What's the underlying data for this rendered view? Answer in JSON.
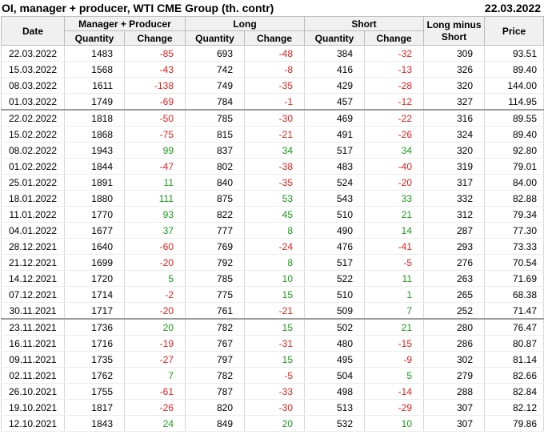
{
  "title": "OI, manager + producer, WTI CME Group (th. contr)",
  "report_date": "22.03.2022",
  "headers": {
    "date": "Date",
    "manager_producer": "Manager + Producer",
    "long": "Long",
    "short": "Short",
    "long_minus_short_line1": "Long minus",
    "long_minus_short_line2": "Short",
    "price": "Price",
    "quantity": "Quantity",
    "change": "Change"
  },
  "colors": {
    "negative": "#e02020",
    "positive": "#1a9a1a",
    "header_bg": "#f0f0f0"
  },
  "rows": [
    {
      "date": "22.03.2022",
      "mp_q": "1483",
      "mp_c": "-85",
      "l_q": "693",
      "l_c": "-48",
      "s_q": "384",
      "s_c": "-32",
      "lms": "309",
      "price": "93.51"
    },
    {
      "date": "15.03.2022",
      "mp_q": "1568",
      "mp_c": "-43",
      "l_q": "742",
      "l_c": "-8",
      "s_q": "416",
      "s_c": "-13",
      "lms": "326",
      "price": "89.40"
    },
    {
      "date": "08.03.2022",
      "mp_q": "1611",
      "mp_c": "-138",
      "l_q": "749",
      "l_c": "-35",
      "s_q": "429",
      "s_c": "-28",
      "lms": "320",
      "price": "144.00"
    },
    {
      "date": "01.03.2022",
      "mp_q": "1749",
      "mp_c": "-69",
      "l_q": "784",
      "l_c": "-1",
      "s_q": "457",
      "s_c": "-12",
      "lms": "327",
      "price": "114.95"
    },
    {
      "date": "22.02.2022",
      "mp_q": "1818",
      "mp_c": "-50",
      "l_q": "785",
      "l_c": "-30",
      "s_q": "469",
      "s_c": "-22",
      "lms": "316",
      "price": "89.55"
    },
    {
      "date": "15.02.2022",
      "mp_q": "1868",
      "mp_c": "-75",
      "l_q": "815",
      "l_c": "-21",
      "s_q": "491",
      "s_c": "-26",
      "lms": "324",
      "price": "89.40"
    },
    {
      "date": "08.02.2022",
      "mp_q": "1943",
      "mp_c": "99",
      "l_q": "837",
      "l_c": "34",
      "s_q": "517",
      "s_c": "34",
      "lms": "320",
      "price": "92.80"
    },
    {
      "date": "01.02.2022",
      "mp_q": "1844",
      "mp_c": "-47",
      "l_q": "802",
      "l_c": "-38",
      "s_q": "483",
      "s_c": "-40",
      "lms": "319",
      "price": "79.01"
    },
    {
      "date": "25.01.2022",
      "mp_q": "1891",
      "mp_c": "11",
      "l_q": "840",
      "l_c": "-35",
      "s_q": "524",
      "s_c": "-20",
      "lms": "317",
      "price": "84.00"
    },
    {
      "date": "18.01.2022",
      "mp_q": "1880",
      "mp_c": "111",
      "l_q": "875",
      "l_c": "53",
      "s_q": "543",
      "s_c": "33",
      "lms": "332",
      "price": "82.88"
    },
    {
      "date": "11.01.2022",
      "mp_q": "1770",
      "mp_c": "93",
      "l_q": "822",
      "l_c": "45",
      "s_q": "510",
      "s_c": "21",
      "lms": "312",
      "price": "79.34"
    },
    {
      "date": "04.01.2022",
      "mp_q": "1677",
      "mp_c": "37",
      "l_q": "777",
      "l_c": "8",
      "s_q": "490",
      "s_c": "14",
      "lms": "287",
      "price": "77.30"
    },
    {
      "date": "28.12.2021",
      "mp_q": "1640",
      "mp_c": "-60",
      "l_q": "769",
      "l_c": "-24",
      "s_q": "476",
      "s_c": "-41",
      "lms": "293",
      "price": "73.33"
    },
    {
      "date": "21.12.2021",
      "mp_q": "1699",
      "mp_c": "-20",
      "l_q": "792",
      "l_c": "8",
      "s_q": "517",
      "s_c": "-5",
      "lms": "276",
      "price": "70.54"
    },
    {
      "date": "14.12.2021",
      "mp_q": "1720",
      "mp_c": "5",
      "l_q": "785",
      "l_c": "10",
      "s_q": "522",
      "s_c": "11",
      "lms": "263",
      "price": "71.69"
    },
    {
      "date": "07.12.2021",
      "mp_q": "1714",
      "mp_c": "-2",
      "l_q": "775",
      "l_c": "15",
      "s_q": "510",
      "s_c": "1",
      "lms": "265",
      "price": "68.38"
    },
    {
      "date": "30.11.2021",
      "mp_q": "1717",
      "mp_c": "-20",
      "l_q": "761",
      "l_c": "-21",
      "s_q": "509",
      "s_c": "7",
      "lms": "252",
      "price": "71.47"
    },
    {
      "date": "23.11.2021",
      "mp_q": "1736",
      "mp_c": "20",
      "l_q": "782",
      "l_c": "15",
      "s_q": "502",
      "s_c": "21",
      "lms": "280",
      "price": "76.47"
    },
    {
      "date": "16.11.2021",
      "mp_q": "1716",
      "mp_c": "-19",
      "l_q": "767",
      "l_c": "-31",
      "s_q": "480",
      "s_c": "-15",
      "lms": "286",
      "price": "80.87"
    },
    {
      "date": "09.11.2021",
      "mp_q": "1735",
      "mp_c": "-27",
      "l_q": "797",
      "l_c": "15",
      "s_q": "495",
      "s_c": "-9",
      "lms": "302",
      "price": "81.14"
    },
    {
      "date": "02.11.2021",
      "mp_q": "1762",
      "mp_c": "7",
      "l_q": "782",
      "l_c": "-5",
      "s_q": "504",
      "s_c": "5",
      "lms": "279",
      "price": "82.66"
    },
    {
      "date": "26.10.2021",
      "mp_q": "1755",
      "mp_c": "-61",
      "l_q": "787",
      "l_c": "-33",
      "s_q": "498",
      "s_c": "-14",
      "lms": "288",
      "price": "82.84"
    },
    {
      "date": "19.10.2021",
      "mp_q": "1817",
      "mp_c": "-26",
      "l_q": "820",
      "l_c": "-30",
      "s_q": "513",
      "s_c": "-29",
      "lms": "307",
      "price": "82.12"
    },
    {
      "date": "12.10.2021",
      "mp_q": "1843",
      "mp_c": "24",
      "l_q": "849",
      "l_c": "20",
      "s_q": "532",
      "s_c": "10",
      "lms": "307",
      "price": "79.86"
    }
  ]
}
